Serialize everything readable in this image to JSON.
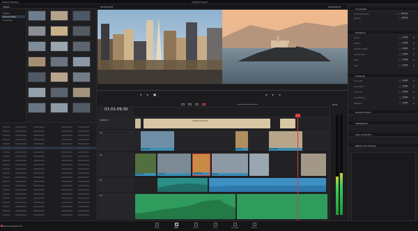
{
  "app": {
    "title": "DaVinci Resolve",
    "project_title": "Untitled Project",
    "brand": "DaVinci Resolve 15"
  },
  "media_pool": {
    "header": "Master",
    "bins": [
      "Master",
      "Source Clips",
      "Timelines"
    ],
    "active_bin": 1,
    "thumb_colors": [
      "#6d7d8d",
      "#b5a28a",
      "#4b5866",
      "#8a8e94",
      "#c9b08a",
      "#545a62",
      "#7f8c99",
      "#9aa5b0",
      "#5c6470",
      "#a58f73",
      "#6b747e",
      "#8c98a5",
      "#4f5a66",
      "#b9a58c",
      "#737c86",
      "#94a0ac",
      "#5a646e",
      "#a1927d",
      "#6a7582",
      "#8f9aa6",
      "#515b66"
    ]
  },
  "viewers": {
    "source_label": "00:00:00:00",
    "program_label": "00:00:00:00"
  },
  "inspector": {
    "sections": [
      "Composite",
      "Transform",
      "Cropping",
      "Dynamic Zoom",
      "Stabilization",
      "Lens Correction",
      "Retime and Scaling"
    ],
    "transform_rows": [
      {
        "label": "Zoom",
        "value": "1.000"
      },
      {
        "label": "Position",
        "value": "0.000"
      },
      {
        "label": "Rotation Angle",
        "value": "0.000"
      },
      {
        "label": "Anchor Point",
        "value": "0.000"
      },
      {
        "label": "Pitch",
        "value": "0.000"
      },
      {
        "label": "Yaw",
        "value": "0.000"
      }
    ],
    "cropping_rows": [
      {
        "label": "Crop Left",
        "value": "0.000"
      },
      {
        "label": "Crop Right",
        "value": "0.000"
      },
      {
        "label": "Crop Top",
        "value": "0.000"
      },
      {
        "label": "Crop Bottom",
        "value": "0.000"
      },
      {
        "label": "Softness",
        "value": "0.000"
      }
    ],
    "composite_mode": "Normal",
    "opacity": "100.00"
  },
  "metadata": {
    "rows": 22,
    "selected_row": 5
  },
  "timeline": {
    "timecode": "01:01:09:30",
    "tracks": [
      {
        "name": "Subtitle 1",
        "kind": "subtitle"
      },
      {
        "name": "V2",
        "kind": "video"
      },
      {
        "name": "V1",
        "kind": "video"
      },
      {
        "name": "A1",
        "kind": "audio"
      },
      {
        "name": "A2",
        "kind": "audio"
      }
    ],
    "subtitle_text": "subtitle text here",
    "clip_labels": [
      "City Aerial",
      "Alcatraz",
      "Bay Bridge",
      "Sunset Pier",
      "Fog Hills",
      "Downtown",
      "Marina"
    ]
  },
  "mixer": {
    "label": "Mixer",
    "meter_levels": [
      0.38,
      0.42
    ]
  },
  "pages": {
    "tabs": [
      "Media",
      "Edit",
      "Fusion",
      "Color",
      "Fairlight",
      "Deliver"
    ],
    "active": 1
  }
}
